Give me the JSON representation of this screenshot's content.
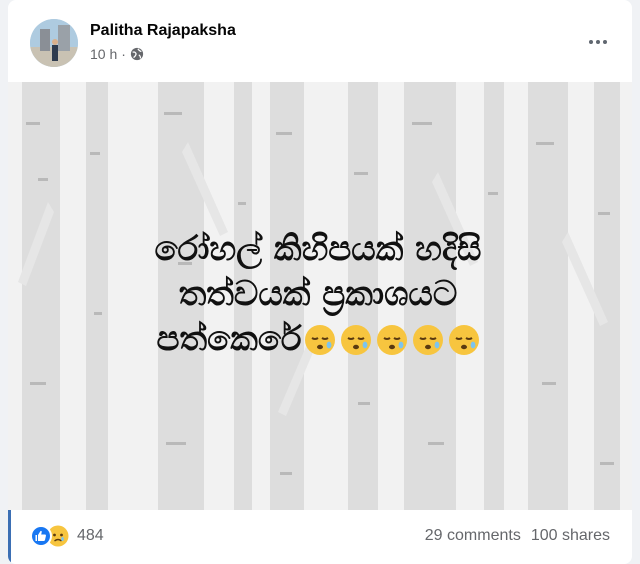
{
  "post": {
    "author": "Palitha Rajapaksha",
    "time": "10 h",
    "separator": "·",
    "privacy_icon": "globe-icon",
    "more_icon": "more-options-icon",
    "text_lines": [
      "රෝහල් කිහිපයක් හදිසි",
      "තත්වයක් ප්‍රකාශයට",
      "පත්කෙරේ"
    ],
    "emojis": [
      "sleepy-face",
      "sleepy-face",
      "sleepy-face",
      "sleepy-face",
      "sleepy-face"
    ]
  },
  "footer": {
    "reaction_icons": [
      "like-icon",
      "sad-icon"
    ],
    "reaction_count": "484",
    "comments": "29 comments",
    "shares": "100 shares"
  },
  "colors": {
    "like_blue": "#1877f2",
    "emoji_yellow": "#f7c53f",
    "accent_bar": "#3b6fb4",
    "meta_gray": "#65676b"
  }
}
